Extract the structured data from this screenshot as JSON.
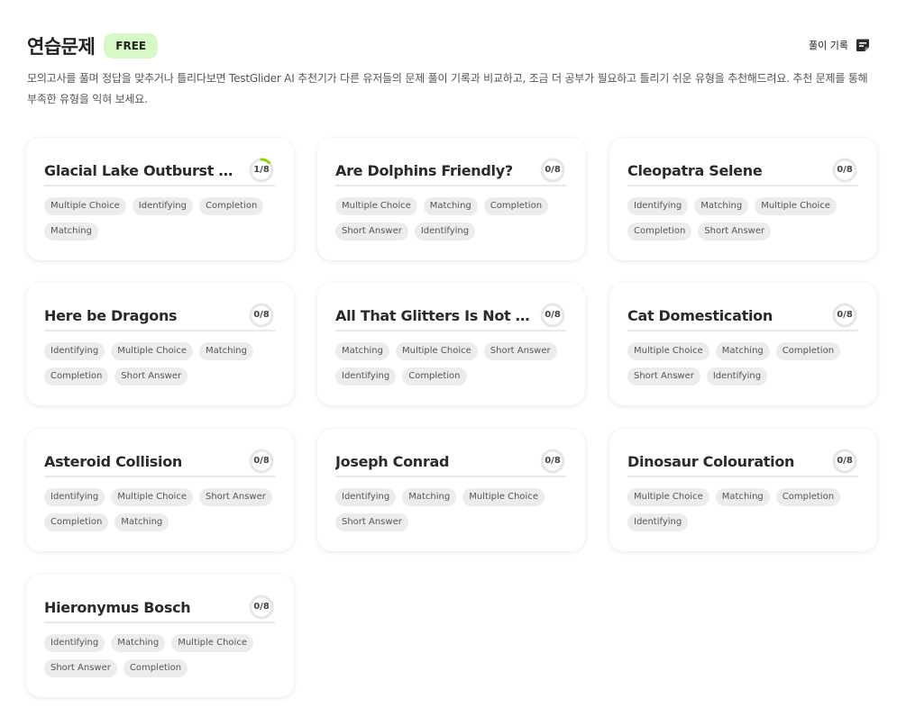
{
  "header": {
    "title": "연습문제",
    "badge": "FREE",
    "history_label": "풀이 기록",
    "description": "모의고사를 풀며 정답을 맞추거나 틀리다보면 TestGlider AI 추천기가 다른 유저들의 문제 풀이 기록과 비교하고, 조금 더 공부가 필요하고 틀리기 쉬운 유형을 추천해드려요. 추천 문제를 통해 부족한 유형을 익혀 보세요."
  },
  "colors": {
    "badge_bg": "#d7f9c6",
    "progress_accent": "#8fd400",
    "progress_track": "#e6e6e6"
  },
  "cards": [
    {
      "title": "Glacial Lake Outburst Floo...",
      "progress_label": "1/8",
      "progress_fraction": 0.125,
      "tags": [
        "Multiple Choice",
        "Identifying",
        "Completion",
        "Matching"
      ]
    },
    {
      "title": "Are Dolphins Friendly?",
      "progress_label": "0/8",
      "progress_fraction": 0,
      "tags": [
        "Multiple Choice",
        "Matching",
        "Completion",
        "Short Answer",
        "Identifying"
      ]
    },
    {
      "title": "Cleopatra Selene",
      "progress_label": "0/8",
      "progress_fraction": 0,
      "tags": [
        "Identifying",
        "Matching",
        "Multiple Choice",
        "Completion",
        "Short Answer"
      ]
    },
    {
      "title": "Here be Dragons",
      "progress_label": "0/8",
      "progress_fraction": 0,
      "tags": [
        "Identifying",
        "Multiple Choice",
        "Matching",
        "Completion",
        "Short Answer"
      ]
    },
    {
      "title": "All That Glitters Is Not Gold",
      "progress_label": "0/8",
      "progress_fraction": 0,
      "tags": [
        "Matching",
        "Multiple Choice",
        "Short Answer",
        "Identifying",
        "Completion"
      ]
    },
    {
      "title": "Cat Domestication",
      "progress_label": "0/8",
      "progress_fraction": 0,
      "tags": [
        "Multiple Choice",
        "Matching",
        "Completion",
        "Short Answer",
        "Identifying"
      ]
    },
    {
      "title": "Asteroid Collision",
      "progress_label": "0/8",
      "progress_fraction": 0,
      "tags": [
        "Identifying",
        "Multiple Choice",
        "Short Answer",
        "Completion",
        "Matching"
      ]
    },
    {
      "title": "Joseph Conrad",
      "progress_label": "0/8",
      "progress_fraction": 0,
      "tags": [
        "Identifying",
        "Matching",
        "Multiple Choice",
        "Short Answer"
      ]
    },
    {
      "title": "Dinosaur Colouration",
      "progress_label": "0/8",
      "progress_fraction": 0,
      "tags": [
        "Multiple Choice",
        "Matching",
        "Completion",
        "Identifying"
      ]
    },
    {
      "title": "Hieronymus Bosch",
      "progress_label": "0/8",
      "progress_fraction": 0,
      "tags": [
        "Identifying",
        "Matching",
        "Multiple Choice",
        "Short Answer",
        "Completion"
      ]
    }
  ]
}
